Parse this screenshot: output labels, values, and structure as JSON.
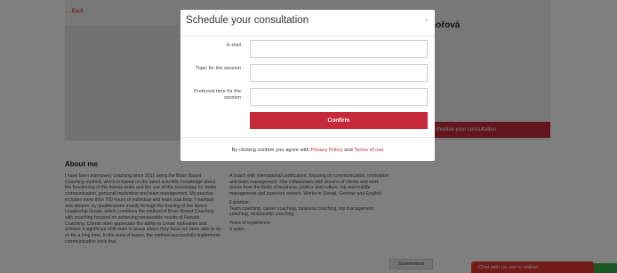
{
  "background_page": {
    "back_label": "← Back",
    "coach_name_partial": "hořová",
    "cta_label": "chedule your consultation",
    "about_title": "About me",
    "about_left": "I have been intensively coaching since 2011 using the Brain Based Coaching method, which is based on the latest scientific knowledge about the functioning of the human brain and the use of this knowledge for better communication, personal motivation and team management. My practice includes more than 700 hours of individual and team coaching. I maintain and deepen my qualifications mainly through the training of the Neuro Leadership Group, which combines the method of Brain Based Coaching with coaching focused on achieving measurable results of Results Coaching. Clients often appreciate the ability to create motivation and achieve a significant shift even in areas where they have not been able to do so for a long time. In the area of teams, the method successfully implements communication tools that",
    "about_right_intro": "A coach with international certification, focusing on communication, motivation and team management. She collaborates with dozens of clients and work teams from the fields of business, politics and culture, top and middle management and business owners. Works in Slovak, German and English.",
    "expertise_label": "Expertise:",
    "expertise_value": "Team coaching, career coaching, business coaching, top management coaching, relationship coaching",
    "experience_label": "Years of experience:",
    "experience_value": "9 years",
    "screenshot_label": "Screenshot",
    "chat_label": "Chat with us, we're online!"
  },
  "modal": {
    "title": "Schedule your consultation",
    "close_symbol": "×",
    "email_label": "E-mail",
    "email_value": "",
    "topic_label": "Topic for the session",
    "topic_value": "",
    "time_label": "Preferred time for the session",
    "time_value": "",
    "confirm_label": "Confirm",
    "consent_prefix": "By clicking confirm you agree with ",
    "privacy_link": "Privacy Policy",
    "consent_and": " and ",
    "terms_link": "Terms of use"
  },
  "colors": {
    "accent": "#c62a3a",
    "overlay": "rgba(0,0,0,0.5)",
    "chat_red": "#e53935",
    "chat_green": "#3aa84a"
  }
}
